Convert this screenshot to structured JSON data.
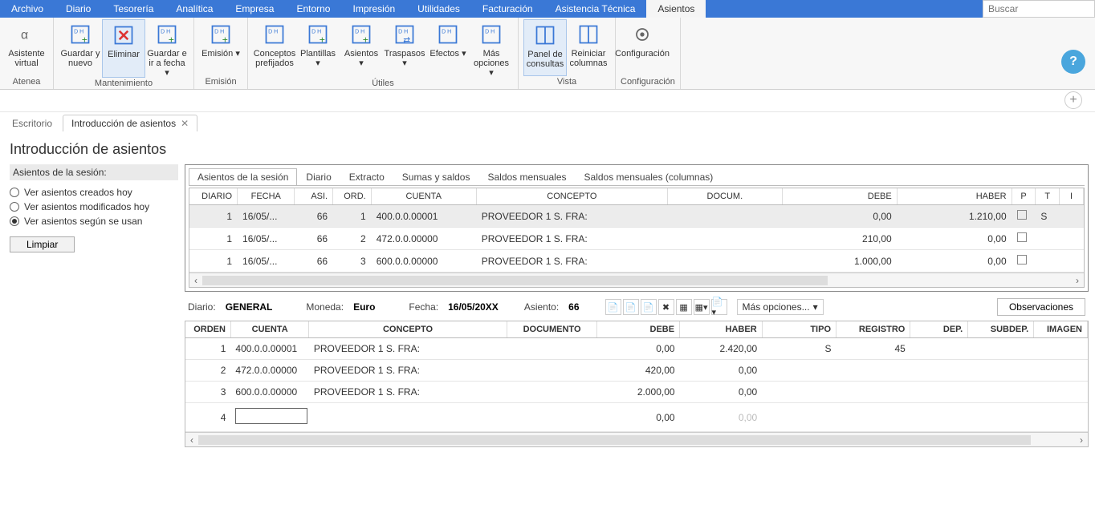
{
  "search_placeholder": "Buscar",
  "menubar": [
    "Archivo",
    "Diario",
    "Tesorería",
    "Analítica",
    "Empresa",
    "Entorno",
    "Impresión",
    "Utilidades",
    "Facturación",
    "Asistencia Técnica",
    "Asientos"
  ],
  "menubar_active_index": 10,
  "ribbon": {
    "groups": [
      {
        "label": "Atenea",
        "buttons": [
          {
            "label": "Asistente virtual",
            "icon": "alpha"
          }
        ]
      },
      {
        "label": "Mantenimiento",
        "buttons": [
          {
            "label": "Guardar y nuevo",
            "icon": "save-new"
          },
          {
            "label": "Eliminar",
            "icon": "delete",
            "active": true
          },
          {
            "label": "Guardar e ir a fecha ▾",
            "icon": "save-date"
          }
        ]
      },
      {
        "label": "Emisión",
        "buttons": [
          {
            "label": "Emisión ▾",
            "icon": "emit"
          }
        ]
      },
      {
        "label": "Útiles",
        "buttons": [
          {
            "label": "Conceptos prefijados",
            "icon": "concept"
          },
          {
            "label": "Plantillas ▾",
            "icon": "template"
          },
          {
            "label": "Asientos ▾",
            "icon": "asiento"
          },
          {
            "label": "Traspasos ▾",
            "icon": "transfer"
          },
          {
            "label": "Efectos ▾",
            "icon": "effects"
          },
          {
            "label": "Más opciones ▾",
            "icon": "more"
          }
        ]
      },
      {
        "label": "Vista",
        "buttons": [
          {
            "label": "Panel de consultas",
            "icon": "panel",
            "active": true
          },
          {
            "label": "Reiniciar columnas",
            "icon": "columns"
          }
        ]
      },
      {
        "label": "Configuración",
        "buttons": [
          {
            "label": "Configuración",
            "icon": "gear"
          }
        ]
      }
    ]
  },
  "doc_tabs": [
    {
      "label": "Escritorio",
      "active": false,
      "closable": false
    },
    {
      "label": "Introducción de asientos",
      "active": true,
      "closable": true
    }
  ],
  "page_title": "Introducción de asientos",
  "sidebar": {
    "title": "Asientos de la sesión:",
    "radios": [
      {
        "label": "Ver asientos creados hoy"
      },
      {
        "label": "Ver asientos modificados hoy"
      },
      {
        "label": "Ver asientos según se usan",
        "selected": true
      }
    ],
    "clear_btn": "Limpiar"
  },
  "inner_tabs": [
    "Asientos de la sesión",
    "Diario",
    "Extracto",
    "Sumas y saldos",
    "Saldos mensuales",
    "Saldos mensuales (columnas)"
  ],
  "inner_tab_active": 0,
  "grid1": {
    "headers": [
      "DIARIO",
      "FECHA",
      "ASI.",
      "ORD.",
      "CUENTA",
      "CONCEPTO",
      "DOCUM.",
      "DEBE",
      "HABER",
      "P",
      "T",
      "I"
    ],
    "rows": [
      {
        "diario": "1",
        "fecha": "16/05/...",
        "asi": "66",
        "ord": "1",
        "cuenta": "400.0.0.00001",
        "concepto": "PROVEEDOR 1 S. FRA:",
        "docum": "",
        "debe": "0,00",
        "haber": "1.210,00",
        "p": "☐",
        "t": "S",
        "selected": true
      },
      {
        "diario": "1",
        "fecha": "16/05/...",
        "asi": "66",
        "ord": "2",
        "cuenta": "472.0.0.00000",
        "concepto": "PROVEEDOR 1 S. FRA:",
        "docum": "",
        "debe": "210,00",
        "haber": "0,00",
        "p": "☐",
        "t": ""
      },
      {
        "diario": "1",
        "fecha": "16/05/...",
        "asi": "66",
        "ord": "3",
        "cuenta": "600.0.0.00000",
        "concepto": "PROVEEDOR 1 S. FRA:",
        "docum": "",
        "debe": "1.000,00",
        "haber": "0,00",
        "p": "☐",
        "t": ""
      }
    ]
  },
  "infobar": {
    "diario_lab": "Diario:",
    "diario_val": "GENERAL",
    "moneda_lab": "Moneda:",
    "moneda_val": "Euro",
    "fecha_lab": "Fecha:",
    "fecha_val": "16/05/20XX",
    "asiento_lab": "Asiento:",
    "asiento_val": "66",
    "more_opts": "Más opciones...",
    "obs_btn": "Observaciones"
  },
  "grid2": {
    "headers": [
      "ORDEN",
      "CUENTA",
      "CONCEPTO",
      "DOCUMENTO",
      "DEBE",
      "HABER",
      "TIPO",
      "REGISTRO",
      "DEP.",
      "SUBDEP.",
      "IMAGEN"
    ],
    "rows": [
      {
        "orden": "1",
        "cuenta": "400.0.0.00001",
        "concepto": "PROVEEDOR 1 S. FRA:",
        "documento": "",
        "debe": "0,00",
        "haber": "2.420,00",
        "tipo": "S",
        "registro": "45",
        "dep": "",
        "subdep": "",
        "imagen": ""
      },
      {
        "orden": "2",
        "cuenta": "472.0.0.00000",
        "concepto": "PROVEEDOR 1 S. FRA:",
        "documento": "",
        "debe": "420,00",
        "haber": "0,00",
        "tipo": "",
        "registro": "",
        "dep": "",
        "subdep": "",
        "imagen": ""
      },
      {
        "orden": "3",
        "cuenta": "600.0.0.00000",
        "concepto": "PROVEEDOR 1 S. FRA:",
        "documento": "",
        "debe": "2.000,00",
        "haber": "0,00",
        "tipo": "",
        "registro": "",
        "dep": "",
        "subdep": "",
        "imagen": ""
      },
      {
        "orden": "4",
        "cuenta": "",
        "concepto": "",
        "documento": "",
        "debe": "0,00",
        "haber": "0,00",
        "haber_faded": true,
        "tipo": "",
        "registro": "",
        "dep": "",
        "subdep": "",
        "imagen": "",
        "editing": true
      }
    ]
  }
}
